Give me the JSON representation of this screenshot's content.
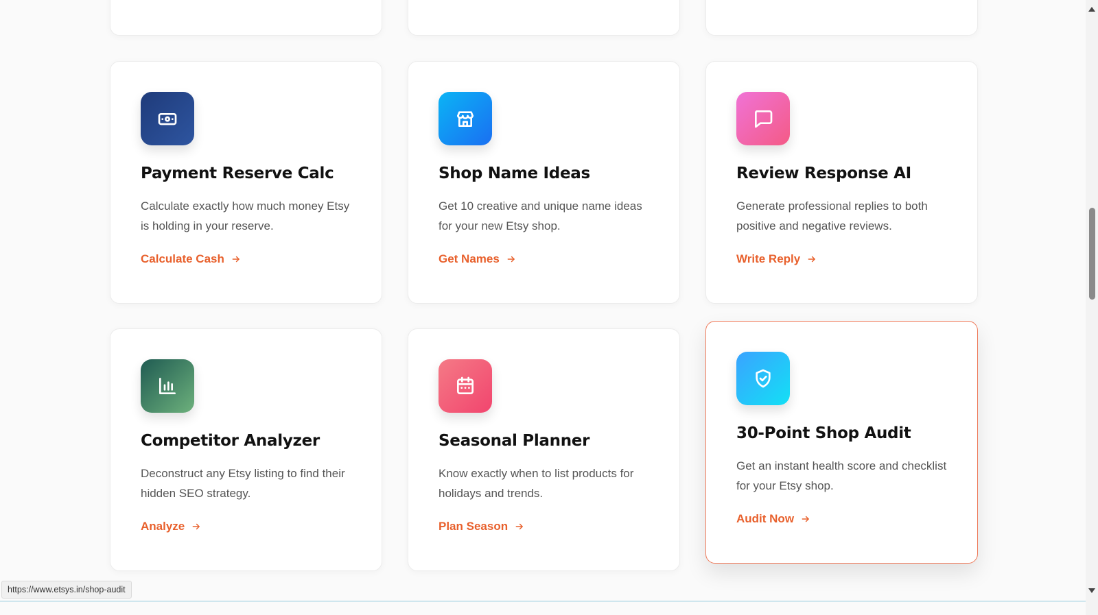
{
  "accent_color": "#e8602c",
  "cards": [
    {
      "title": "Payment Reserve Calc",
      "description": "Calculate exactly how much money Etsy is holding in your reserve.",
      "link": "Calculate Cash",
      "icon": "money-icon",
      "icon_gradient": [
        "#1f3b7a",
        "#2e55a0"
      ]
    },
    {
      "title": "Shop Name Ideas",
      "description": "Get 10 creative and unique name ideas for your new Etsy shop.",
      "link": "Get Names",
      "icon": "store-icon",
      "icon_gradient": [
        "#0bb4f5",
        "#1a6ff2"
      ]
    },
    {
      "title": "Review Response AI",
      "description": "Generate professional replies to both positive and negative reviews.",
      "link": "Write Reply",
      "icon": "message-icon",
      "icon_gradient": [
        "#f073d6",
        "#f45a86"
      ]
    },
    {
      "title": "Competitor Analyzer",
      "description": "Deconstruct any Etsy listing to find their hidden SEO strategy.",
      "link": "Analyze",
      "icon": "bar-chart-icon",
      "icon_gradient": [
        "#1f5b52",
        "#6db17c"
      ]
    },
    {
      "title": "Seasonal Planner",
      "description": "Know exactly when to list products for holidays and trends.",
      "link": "Plan Season",
      "icon": "calendar-icon",
      "icon_gradient": [
        "#f47a86",
        "#f2456e"
      ]
    },
    {
      "title": "30-Point Shop Audit",
      "description": "Get an instant health score and checklist for your Etsy shop.",
      "link": "Audit Now",
      "icon": "shield-check-icon",
      "icon_gradient": [
        "#3aa3ff",
        "#13e0f5"
      ],
      "featured": true
    }
  ],
  "status_bar": {
    "url": "https://www.etsys.in/shop-audit"
  }
}
